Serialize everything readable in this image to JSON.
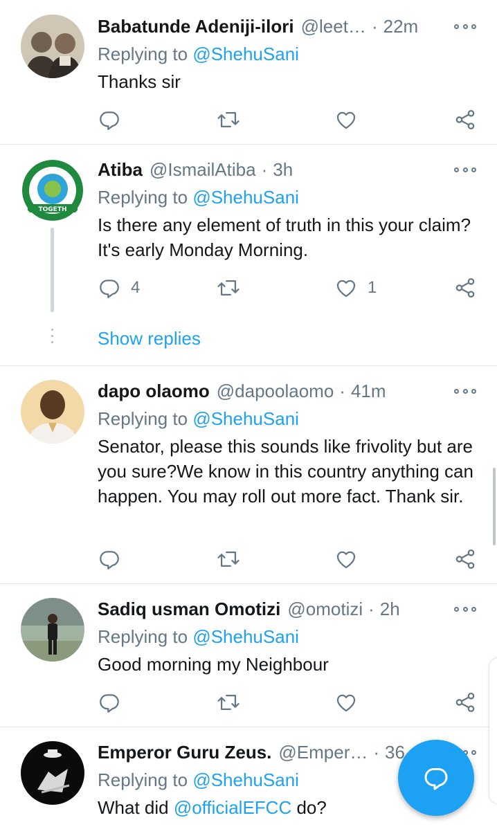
{
  "replying_prefix": "Replying to",
  "show_replies": "Show replies",
  "tweets": [
    {
      "name": "Babatunde Adeniji-ilori",
      "handle": "@leet…",
      "time": "22m",
      "replying_to": "@ShehuSani",
      "text": "Thanks sir",
      "reply_count": "",
      "like_count": ""
    },
    {
      "name": "Atiba",
      "handle": "@IsmailAtiba",
      "time": "3h",
      "replying_to": "@ShehuSani",
      "text": "Is there any element of truth in this your claim? It's early Monday Morning.",
      "reply_count": "4",
      "like_count": "1"
    },
    {
      "name": "dapo olaomo",
      "handle": "@dapoolaomo",
      "time": "41m",
      "replying_to": "@ShehuSani",
      "text": "Senator, please this sounds like frivolity but are you sure?We know in this country anything can happen. You may roll out more fact. Thank sir.",
      "reply_count": "",
      "like_count": ""
    },
    {
      "name": "Sadiq usman Omotizi",
      "handle": "@omotizi",
      "time": "2h",
      "replying_to": "@ShehuSani",
      "text": "Good morning my Neighbour",
      "reply_count": "",
      "like_count": ""
    },
    {
      "name": "Emperor Guru Zeus.",
      "handle": "@Emper…",
      "time": "36",
      "replying_to": "@ShehuSani",
      "text_prefix": "What did ",
      "text_mention": "@officialEFCC",
      "text_suffix": " do?"
    }
  ],
  "icons": {
    "reply": "reply-icon",
    "retweet": "retweet-icon",
    "like": "heart-icon",
    "share": "share-icon",
    "more": "more-options-icon",
    "compose": "compose-reply-icon"
  },
  "colors": {
    "accent": "#1da1f2",
    "secondary_text": "#657786",
    "primary_text": "#14171a",
    "divider": "#e1e8ed"
  }
}
